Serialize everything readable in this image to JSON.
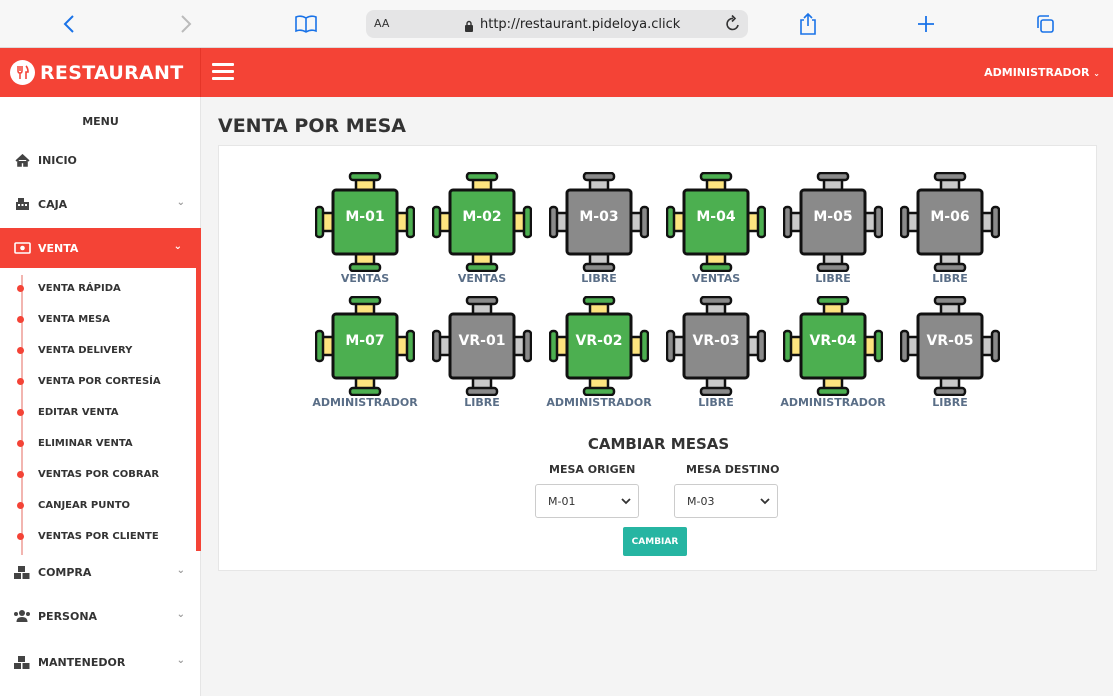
{
  "browser": {
    "font_size_label": "AA",
    "url": "http://restaurant.pideloya.click"
  },
  "brand": {
    "name": "RESTAURANT",
    "color": "#f44336"
  },
  "header": {
    "user": "ADMINISTRADOR"
  },
  "sidebar": {
    "title": "MENU",
    "items": [
      {
        "label": "INICIO",
        "icon": "home-icon"
      },
      {
        "label": "CAJA",
        "icon": "cash-register-icon"
      },
      {
        "label": "VENTA",
        "icon": "money-bill-icon",
        "active": true
      },
      {
        "label": "COMPRA",
        "icon": "cubes-icon"
      },
      {
        "label": "PERSONA",
        "icon": "users-icon"
      },
      {
        "label": "MANTENEDOR",
        "icon": "cubes-icon"
      }
    ],
    "venta_sub": [
      "VENTA RÁPIDA",
      "VENTA MESA",
      "VENTA DELIVERY",
      "VENTA POR CORTESÍA",
      "EDITAR VENTA",
      "ELIMINAR VENTA",
      "VENTAS POR COBRAR",
      "CANJEAR PUNTO",
      "VENTAS POR CLIENTE"
    ]
  },
  "page": {
    "title": "VENTA POR MESA"
  },
  "tables": [
    {
      "label": "M-01",
      "status": "VENTAS",
      "state": "occupied"
    },
    {
      "label": "M-02",
      "status": "VENTAS",
      "state": "occupied"
    },
    {
      "label": "M-03",
      "status": "LIBRE",
      "state": "free"
    },
    {
      "label": "M-04",
      "status": "VENTAS",
      "state": "occupied"
    },
    {
      "label": "M-05",
      "status": "LIBRE",
      "state": "free"
    },
    {
      "label": "M-06",
      "status": "LIBRE",
      "state": "free"
    },
    {
      "label": "M-07",
      "status": "ADMINISTRADOR",
      "state": "occupied"
    },
    {
      "label": "VR-01",
      "status": "LIBRE",
      "state": "free"
    },
    {
      "label": "VR-02",
      "status": "ADMINISTRADOR",
      "state": "occupied"
    },
    {
      "label": "VR-03",
      "status": "LIBRE",
      "state": "free"
    },
    {
      "label": "VR-04",
      "status": "ADMINISTRADOR",
      "state": "occupied"
    },
    {
      "label": "VR-05",
      "status": "LIBRE",
      "state": "free"
    }
  ],
  "colors": {
    "occupied": "#4caf50",
    "free": "#8a8a8a",
    "chair_occupied": "#fde47f",
    "chair_free": "#c9c9c9",
    "accent": "#f44336",
    "button": "#26b5a2"
  },
  "change": {
    "title": "CAMBIAR MESAS",
    "origin_label": "MESA ORIGEN",
    "origin_value": "M-01",
    "dest_label": "MESA DESTINO",
    "dest_value": "M-03",
    "button": "CAMBIAR"
  }
}
